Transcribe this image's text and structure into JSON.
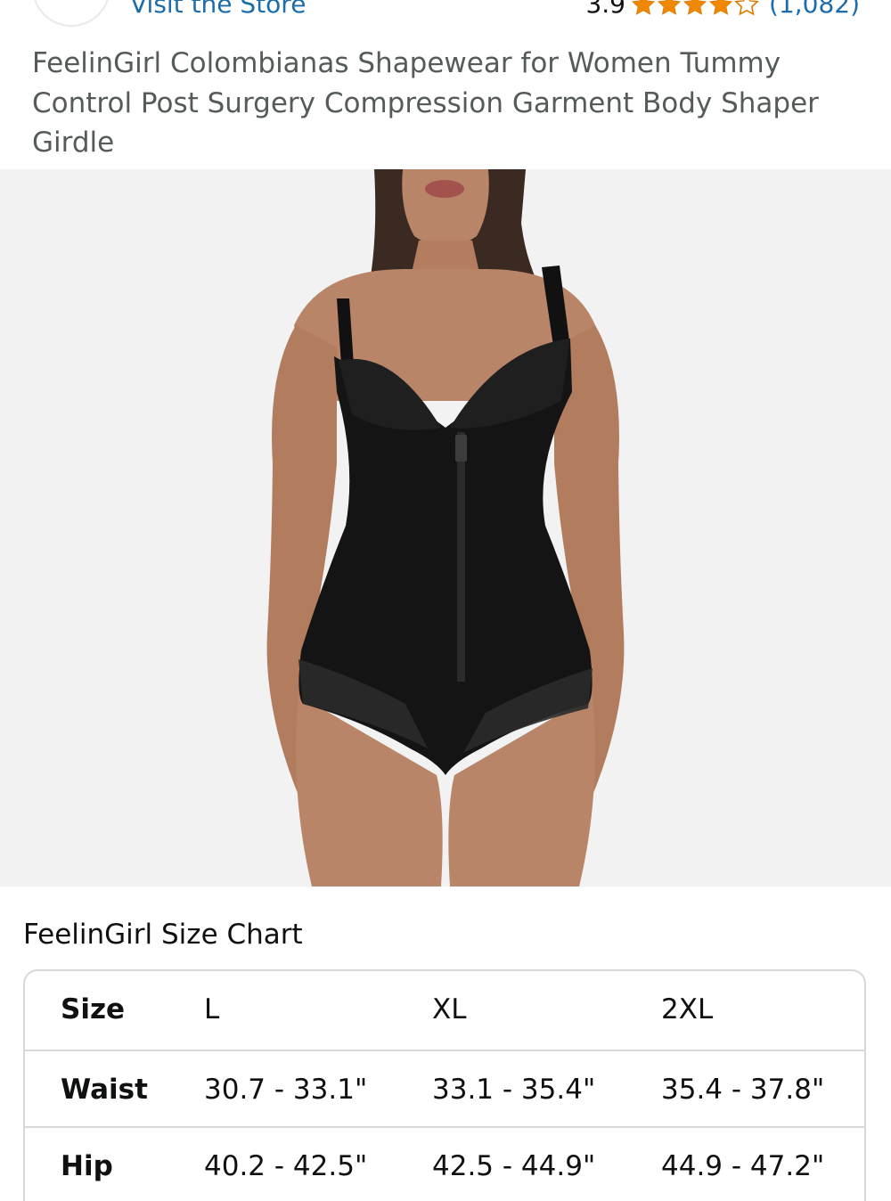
{
  "header": {
    "store_link": "Visit the Store",
    "rating_value": "3.9",
    "rating_stars": 3.9,
    "rating_count": "(1,082)"
  },
  "product": {
    "title": "FeelinGirl Colombianas Shapewear for Women Tummy Control Post Surgery Compression Garment Body Shaper Girdle"
  },
  "size_chart": {
    "heading": "FeelinGirl Size Chart",
    "header_row": [
      "Size",
      "L",
      "XL",
      "2XL"
    ],
    "rows": [
      [
        "Waist",
        "30.7 - 33.1\"",
        "33.1 - 35.4\"",
        "35.4 - 37.8\""
      ],
      [
        "Hip",
        "40.2 - 42.5\"",
        "42.5 - 44.9\"",
        "44.9 - 47.2\""
      ]
    ]
  },
  "colors": {
    "link": "#1c6caa",
    "star": "#f08804",
    "title_text": "#555a5b",
    "image_bg": "#f2f2f2",
    "table_border": "#d5d9d9"
  }
}
